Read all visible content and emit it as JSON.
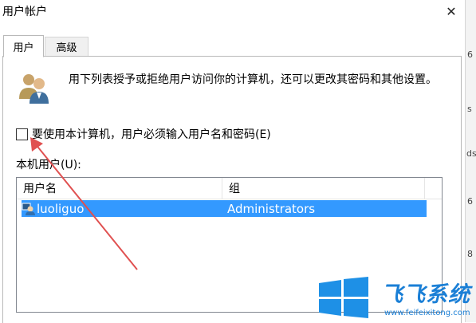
{
  "window": {
    "title": "用户帐户"
  },
  "tabs": [
    {
      "label": "用户"
    },
    {
      "label": "高级"
    }
  ],
  "description": "用下列表授予或拒绝用户访问你的计算机，还可以更改其密码和其他设置。",
  "require_login": {
    "label": "要使用本计算机，用户必须输入用户名和密码(E)",
    "checked": false
  },
  "local_users": {
    "label": "本机用户(U):",
    "columns": [
      "用户名",
      "组"
    ],
    "rows": [
      {
        "username": "luoliguo",
        "group": "Administrators",
        "selected": true
      }
    ]
  },
  "right_strip_marks": [
    "6",
    "s",
    "ds",
    "6",
    "8"
  ],
  "watermark": {
    "title": "飞飞系统",
    "url": "www.feifeixitong.com"
  },
  "colors": {
    "selection": "#3399ff",
    "arrow": "#e05050",
    "watermark": "#1a7fd6"
  }
}
